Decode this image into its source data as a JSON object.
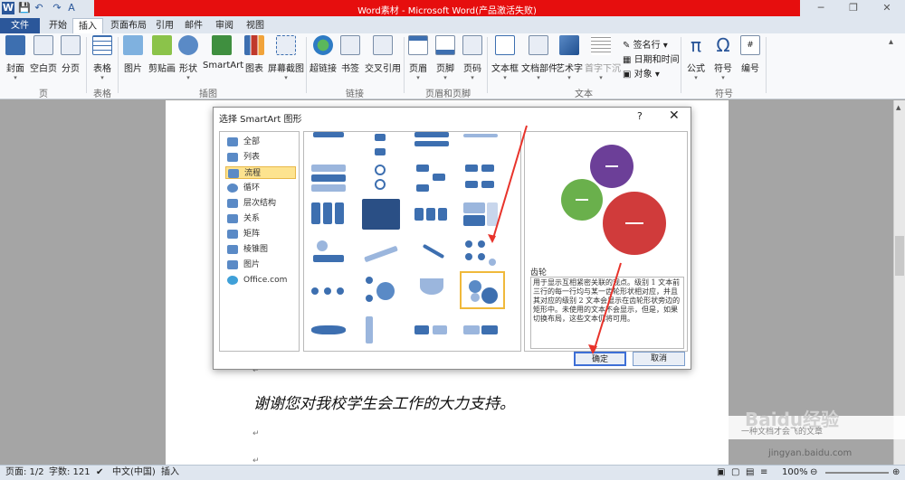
{
  "titlebar": {
    "title": "Word素材 - Microsoft Word(产品激活失败)",
    "app_icon": "W"
  },
  "tabs": [
    "文件",
    "开始",
    "插入",
    "页面布局",
    "引用",
    "邮件",
    "审阅",
    "视图"
  ],
  "ribbon": {
    "page_group": {
      "label": "页",
      "buttons": [
        "封面",
        "空白页",
        "分页"
      ]
    },
    "table_group": {
      "label": "表格",
      "buttons": [
        "表格"
      ]
    },
    "illust_group": {
      "label": "插图",
      "buttons": [
        "图片",
        "剪贴画",
        "形状",
        "SmartArt",
        "图表",
        "屏幕截图"
      ]
    },
    "links_group": {
      "label": "链接",
      "buttons": [
        "超链接",
        "书签",
        "交叉引用"
      ]
    },
    "hf_group": {
      "label": "页眉和页脚",
      "buttons": [
        "页眉",
        "页脚",
        "页码"
      ]
    },
    "text_group": {
      "label": "文本",
      "buttons": [
        "文本框",
        "文档部件",
        "艺术字",
        "首字下沉"
      ],
      "small": [
        "签名行",
        "日期和时间",
        "对象"
      ]
    },
    "symbol_group": {
      "label": "符号",
      "buttons": [
        "公式",
        "符号",
        "编号"
      ]
    }
  },
  "dialog": {
    "title": "选择 SmartArt 图形",
    "help": "?",
    "close": "✕",
    "categories": [
      "全部",
      "列表",
      "流程",
      "循环",
      "层次结构",
      "关系",
      "矩阵",
      "棱锥图",
      "图片",
      "Office.com"
    ],
    "selected_category": "流程",
    "preview_name": "齿轮",
    "preview_desc": "用于显示互相紧密关联的观点。级别 1 文本前三行的每一行均与某一齿轮形状相对应，并且其对应的级别 2 文本会显示在齿轮形状旁边的矩形中。未使用的文本不会显示，但是，如果切换布局，这些文本仍将可用。",
    "ok": "确定",
    "cancel": "取消"
  },
  "document": {
    "thanks": "谢谢您对我校学生会工作的大力支持。",
    "para_mark": "↵"
  },
  "statusbar": {
    "page": "页面: 1/2",
    "words": "字数: 121",
    "lang": "中文(中国)",
    "mode": "插入",
    "zoom": "100%"
  },
  "watermark": {
    "logo": "Baidu经验",
    "url": "jingyan.baidu.com",
    "caption": "一种文档才会飞的文章"
  }
}
